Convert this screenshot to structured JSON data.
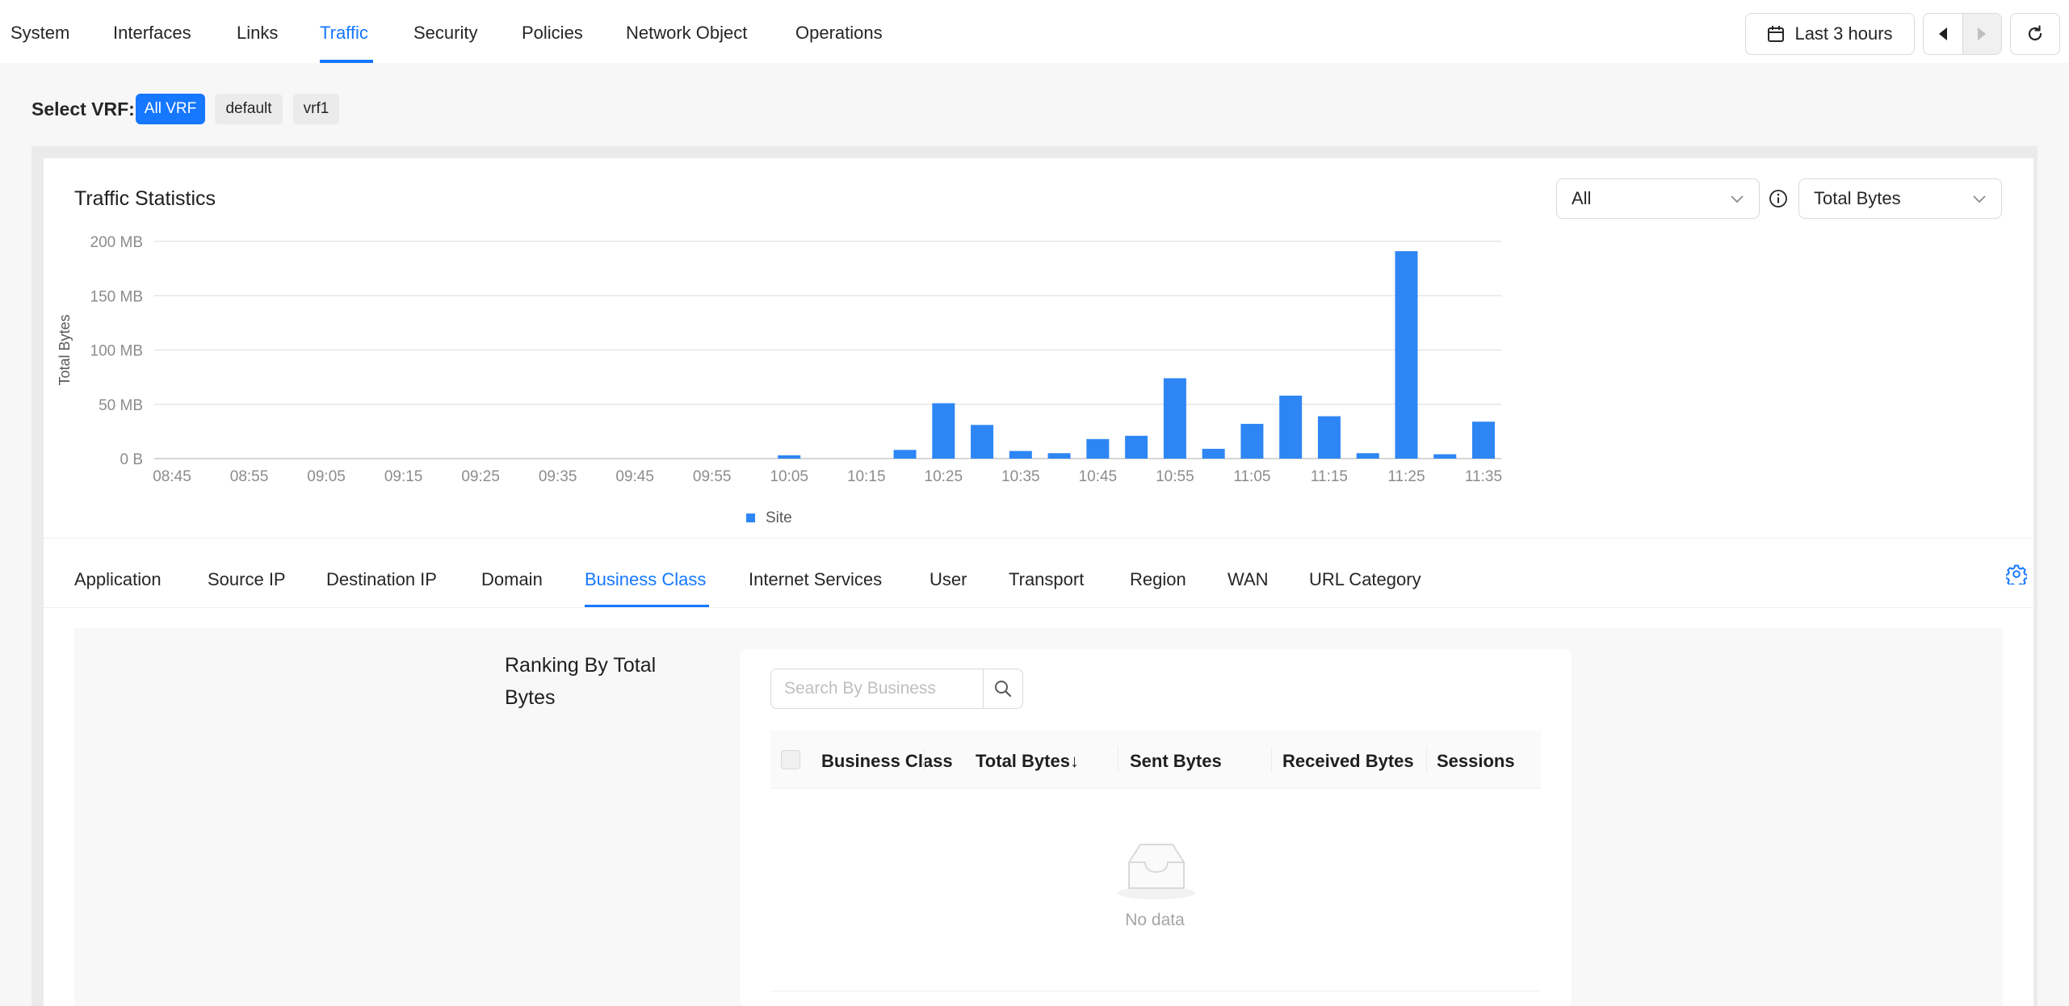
{
  "nav": {
    "tabs": [
      "System",
      "Interfaces",
      "Links",
      "Traffic",
      "Security",
      "Policies",
      "Network Object",
      "Operations"
    ],
    "active": "Traffic"
  },
  "toolbar": {
    "time_range": "Last 3 hours",
    "calendar_icon": "calendar-icon",
    "prev_icon": "caret-left-icon",
    "next_icon": "caret-right-icon",
    "refresh_icon": "refresh-icon"
  },
  "vrf": {
    "label": "Select VRF:",
    "options": [
      "All VRF",
      "default",
      "vrf1"
    ],
    "selected": "All VRF"
  },
  "traffic": {
    "title": "Traffic Statistics",
    "filter_select": "All",
    "metric_select": "Total Bytes"
  },
  "chart_data": {
    "type": "bar",
    "ylabel": "Total Bytes",
    "ylim": [
      0,
      200
    ],
    "yticks": [
      "0 B",
      "50 MB",
      "100 MB",
      "150 MB",
      "200 MB"
    ],
    "xticks": [
      "08:45",
      "08:55",
      "09:05",
      "09:15",
      "09:25",
      "09:35",
      "09:45",
      "09:55",
      "10:05",
      "10:15",
      "10:25",
      "10:35",
      "10:45",
      "10:55",
      "11:05",
      "11:15",
      "11:25",
      "11:35"
    ],
    "legend_position": "bottom",
    "series": [
      {
        "name": "Site",
        "color": "#2e86f5",
        "x": [
          "10:05",
          "10:20",
          "10:25",
          "10:30",
          "10:35",
          "10:40",
          "10:45",
          "10:50",
          "10:55",
          "11:00",
          "11:05",
          "11:10",
          "11:15",
          "11:20",
          "11:25",
          "11:30",
          "11:35"
        ],
        "values": [
          3,
          8,
          51,
          31,
          7,
          5,
          18,
          21,
          74,
          9,
          32,
          58,
          39,
          5,
          191,
          4,
          34
        ]
      }
    ],
    "grid": true
  },
  "subtabs": {
    "items": [
      "Application",
      "Source IP",
      "Destination IP",
      "Domain",
      "Business Class",
      "Internet Services",
      "User",
      "Transport",
      "Region",
      "WAN",
      "URL Category"
    ],
    "active": "Business Class"
  },
  "ranking": {
    "title": "Ranking By Total Bytes",
    "search_placeholder": "Search By Business",
    "columns": [
      "Business Class",
      "Total Bytes",
      "Sent Bytes",
      "Received Bytes",
      "Sessions"
    ],
    "sort_indicator": "↓",
    "empty_text": "No data"
  }
}
